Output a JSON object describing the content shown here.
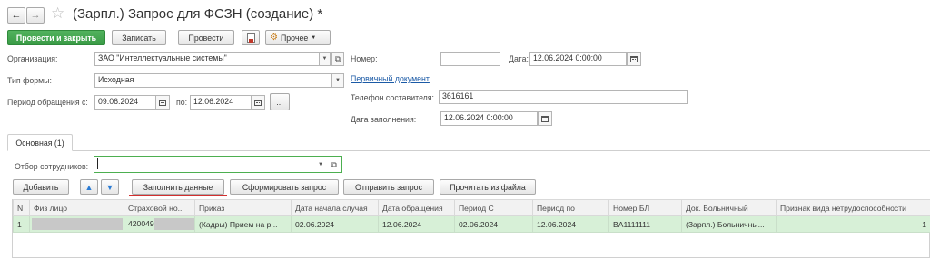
{
  "window": {
    "title": "(Зарпл.) Запрос для ФСЗН (создание) *"
  },
  "toolbar": {
    "post_close": "Провести и закрыть",
    "save": "Записать",
    "post": "Провести",
    "more": "Прочее"
  },
  "form": {
    "org_label": "Организация:",
    "org_value": "ЗАО \"Интеллектуальные системы\"",
    "number_label": "Номер:",
    "number_value": "",
    "date_label": "Дата:",
    "date_value": "12.06.2024  0:00:00",
    "form_type_label": "Тип формы:",
    "form_type_value": "Исходная",
    "primary_doc_link": "Первичный документ",
    "period_label": "Период обращения с:",
    "period_from": "09.06.2024",
    "period_to_label": "по:",
    "period_to": "12.06.2024",
    "phone_label": "Телефон составителя:",
    "phone_value": "3616161",
    "fill_date_label": "Дата заполнения:",
    "fill_date_value": "12.06.2024  0:00:00"
  },
  "tabs": [
    {
      "label": "Основная (1)"
    }
  ],
  "filter": {
    "label": "Отбор сотрудников:",
    "value": ""
  },
  "table_buttons": {
    "add": "Добавить",
    "fill": "Заполнить данные",
    "form_request": "Сформировать запрос",
    "send_request": "Отправить запрос",
    "read_file": "Прочитать из файла"
  },
  "table": {
    "columns": [
      "N",
      "Физ лицо",
      "Страховой но...",
      "Приказ",
      "Дата начала случая",
      "Дата обращения",
      "Период С",
      "Период по",
      "Номер БЛ",
      "Док. Больничный",
      "Признак вида нетрудоспособности"
    ],
    "rows": [
      {
        "n": "1",
        "person": "",
        "insurance": "420049",
        "order": "(Кадры) Прием на р...",
        "case_start": "02.06.2024",
        "appeal_date": "12.06.2024",
        "period_from": "02.06.2024",
        "period_to": "12.06.2024",
        "sick_number": "BA1111111",
        "sick_doc": "(Зарпл.) Больничны...",
        "disability_sign": "1"
      }
    ]
  },
  "colors": {
    "primary_green": "#3fa34b",
    "row_highlight": "#d7f0d7",
    "link_blue": "#1b5aa6",
    "filter_border": "#4caf50",
    "underline_red": "#d32f2f"
  }
}
